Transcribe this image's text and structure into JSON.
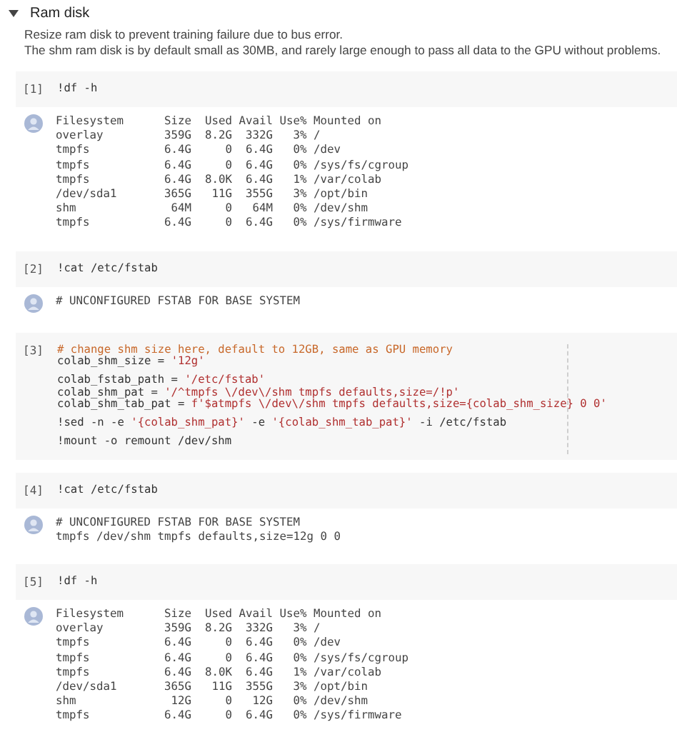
{
  "section": {
    "title": "Ram disk",
    "expanded": true,
    "description": [
      "Resize ram disk to prevent training failure due to bus error.",
      "The shm ram disk is by default small as 30MB, and rarely large enough to pass all data to the GPU without problems."
    ]
  },
  "cells": [
    {
      "prompt": "[1]",
      "ruler": false,
      "code_blocks": [
        {
          "lines": [
            {
              "segments": [
                {
                  "kind": "plain",
                  "text": "!df -h"
                }
              ]
            }
          ]
        }
      ],
      "output": [
        "Filesystem      Size  Used Avail Use% Mounted on",
        "overlay         359G  8.2G  332G   3% /",
        "tmpfs           6.4G     0  6.4G   0% /dev",
        "tmpfs           6.4G     0  6.4G   0% /sys/fs/cgroup",
        "tmpfs           6.4G  8.0K  6.4G   1% /var/colab",
        "/dev/sda1       365G   11G  355G   3% /opt/bin",
        "shm              64M     0   64M   0% /dev/shm",
        "tmpfs           6.4G     0  6.4G   0% /sys/firmware"
      ]
    },
    {
      "prompt": "[2]",
      "ruler": false,
      "code_blocks": [
        {
          "lines": [
            {
              "segments": [
                {
                  "kind": "plain",
                  "text": "!cat /etc/fstab"
                }
              ]
            }
          ]
        }
      ],
      "output": [
        "# UNCONFIGURED FSTAB FOR BASE SYSTEM"
      ]
    },
    {
      "prompt": "[3]",
      "ruler": true,
      "code_blocks": [
        {
          "lines": [
            {
              "segments": [
                {
                  "kind": "comment",
                  "text": "# change shm size here, default to 12GB, same as GPU memory"
                }
              ]
            },
            {
              "segments": [
                {
                  "kind": "plain",
                  "text": "colab_shm_size = "
                },
                {
                  "kind": "string",
                  "text": "'12g'"
                }
              ]
            }
          ]
        },
        {
          "lines": [
            {
              "segments": [
                {
                  "kind": "plain",
                  "text": "colab_fstab_path = "
                },
                {
                  "kind": "string",
                  "text": "'/etc/fstab'"
                }
              ]
            },
            {
              "segments": [
                {
                  "kind": "plain",
                  "text": "colab_shm_pat = "
                },
                {
                  "kind": "string",
                  "text": "'/^tmpfs \\/dev\\/shm tmpfs defaults,size=/!p'"
                }
              ]
            },
            {
              "segments": [
                {
                  "kind": "plain",
                  "text": "colab_shm_tab_pat = "
                },
                {
                  "kind": "string",
                  "text": "f'$atmpfs \\/dev\\/shm tmpfs defaults,size={colab_shm_size} 0 0'"
                }
              ]
            }
          ]
        },
        {
          "lines": [
            {
              "segments": [
                {
                  "kind": "plain",
                  "text": "!sed -n -e "
                },
                {
                  "kind": "string",
                  "text": "'{colab_shm_pat}'"
                },
                {
                  "kind": "plain",
                  "text": " -e "
                },
                {
                  "kind": "string",
                  "text": "'{colab_shm_tab_pat}'"
                },
                {
                  "kind": "plain",
                  "text": " -i /etc/fstab"
                }
              ]
            }
          ]
        },
        {
          "lines": [
            {
              "segments": [
                {
                  "kind": "plain",
                  "text": "!mount -o remount /dev/shm"
                }
              ]
            }
          ]
        }
      ]
    },
    {
      "prompt": "[4]",
      "ruler": false,
      "code_blocks": [
        {
          "lines": [
            {
              "segments": [
                {
                  "kind": "plain",
                  "text": "!cat /etc/fstab"
                }
              ]
            }
          ]
        }
      ],
      "output": [
        "# UNCONFIGURED FSTAB FOR BASE SYSTEM",
        "tmpfs /dev/shm tmpfs defaults,size=12g 0 0"
      ]
    },
    {
      "prompt": "[5]",
      "ruler": false,
      "code_blocks": [
        {
          "lines": [
            {
              "segments": [
                {
                  "kind": "plain",
                  "text": "!df -h"
                }
              ]
            }
          ]
        }
      ],
      "output": [
        "Filesystem      Size  Used Avail Use% Mounted on",
        "overlay         359G  8.2G  332G   3% /",
        "tmpfs           6.4G     0  6.4G   0% /dev",
        "tmpfs           6.4G     0  6.4G   0% /sys/fs/cgroup",
        "tmpfs           6.4G  8.0K  6.4G   1% /var/colab",
        "/dev/sda1       365G   11G  355G   3% /opt/bin",
        "shm              12G     0   12G   0% /dev/shm",
        "tmpfs           6.4G     0  6.4G   0% /sys/firmware"
      ]
    }
  ]
}
